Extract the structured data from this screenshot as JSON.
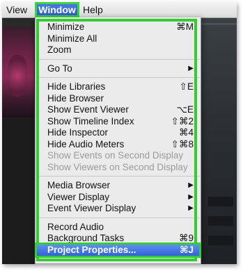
{
  "menubar": {
    "items": [
      "View",
      "Window",
      "Help"
    ],
    "active": "Window"
  },
  "menu": {
    "groups": [
      [
        {
          "label": "Minimize",
          "shortcut": "⌘M",
          "enabled": true
        },
        {
          "label": "Minimize All",
          "shortcut": "",
          "enabled": true
        },
        {
          "label": "Zoom",
          "shortcut": "",
          "enabled": true
        }
      ],
      [
        {
          "label": "Go To",
          "shortcut": "",
          "submenu": true,
          "enabled": true
        }
      ],
      [
        {
          "label": "Hide Libraries",
          "shortcut": "⇧E",
          "enabled": true
        },
        {
          "label": "Hide Browser",
          "shortcut": "",
          "enabled": true
        },
        {
          "label": "Show Event Viewer",
          "shortcut": "⌥E",
          "enabled": true
        },
        {
          "label": "Show Timeline Index",
          "shortcut": "⇧⌘2",
          "enabled": true
        },
        {
          "label": "Hide Inspector",
          "shortcut": "⌘4",
          "enabled": true
        },
        {
          "label": "Hide Audio Meters",
          "shortcut": "⇧⌘8",
          "enabled": true
        },
        {
          "label": "Show Events on Second Display",
          "shortcut": "",
          "enabled": false
        },
        {
          "label": "Show Viewers on Second Display",
          "shortcut": "",
          "enabled": false
        }
      ],
      [
        {
          "label": "Media Browser",
          "shortcut": "",
          "submenu": true,
          "enabled": true
        },
        {
          "label": "Viewer Display",
          "shortcut": "",
          "submenu": true,
          "enabled": true
        },
        {
          "label": "Event Viewer Display",
          "shortcut": "",
          "submenu": true,
          "enabled": true
        }
      ],
      [
        {
          "label": "Record Audio",
          "shortcut": "",
          "enabled": true
        },
        {
          "label": "Background Tasks",
          "shortcut": "⌘9",
          "enabled": true
        },
        {
          "label": "Project Properties...",
          "shortcut": "⌘J",
          "enabled": true,
          "selected": true
        }
      ]
    ]
  },
  "colors": {
    "highlight": "#3362d8",
    "annotation_outline": "#33cc33",
    "menu_bg": "#f0f0f0"
  }
}
